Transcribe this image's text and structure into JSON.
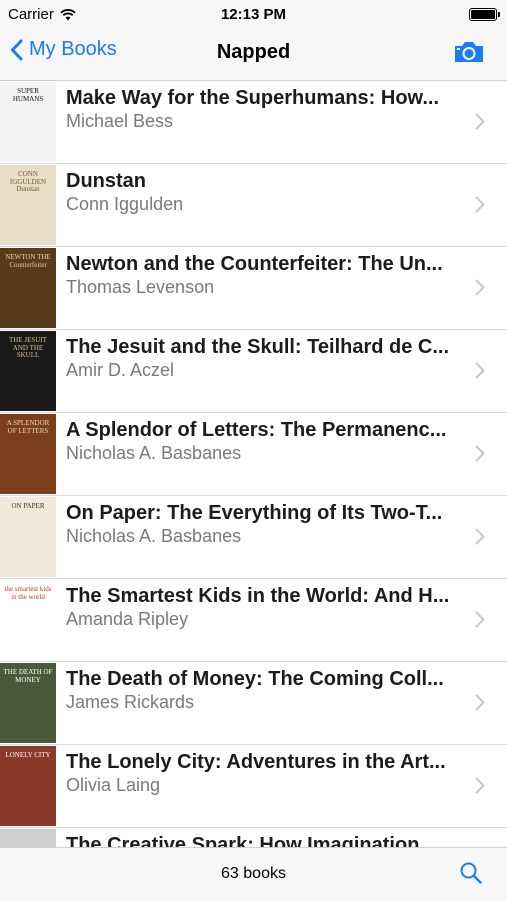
{
  "status": {
    "carrier": "Carrier",
    "time": "12:13 PM"
  },
  "nav": {
    "back_label": "My Books",
    "title": "Napped"
  },
  "books": [
    {
      "title": "Make Way for the Superhumans: How...",
      "author": "Michael Bess",
      "cover_text": "SUPER HUMANS",
      "cover_bg": "#f3f3f3",
      "cover_fg": "#111111"
    },
    {
      "title": "Dunstan",
      "author": "Conn Iggulden",
      "cover_text": "CONN IGGULDEN Dunstan",
      "cover_bg": "#e7dcc4",
      "cover_fg": "#7a5a2a"
    },
    {
      "title": "Newton and the Counterfeiter: The Un...",
      "author": "Thomas Levenson",
      "cover_text": "NEWTON THE Counterfeiter",
      "cover_bg": "#5a3a1d",
      "cover_fg": "#e8d3a0"
    },
    {
      "title": "The Jesuit and the Skull: Teilhard de C...",
      "author": "Amir D. Aczel",
      "cover_text": "THE JESUIT AND THE SKULL",
      "cover_bg": "#1a1a1a",
      "cover_fg": "#d8c08a"
    },
    {
      "title": "A Splendor of Letters: The Permanenc...",
      "author": "Nicholas A. Basbanes",
      "cover_text": "A SPLENDOR OF LETTERS",
      "cover_bg": "#7a3f1a",
      "cover_fg": "#f0dbb0"
    },
    {
      "title": "On Paper: The Everything of Its Two-T...",
      "author": "Nicholas A. Basbanes",
      "cover_text": "ON PAPER",
      "cover_bg": "#efe9dc",
      "cover_fg": "#333333"
    },
    {
      "title": "The Smartest Kids in the World: And H...",
      "author": "Amanda Ripley",
      "cover_text": "the smartest kids in the world",
      "cover_bg": "#ffffff",
      "cover_fg": "#c0392b"
    },
    {
      "title": "The Death of Money: The Coming Coll...",
      "author": "James Rickards",
      "cover_text": "THE DEATH OF MONEY",
      "cover_bg": "#4a5a38",
      "cover_fg": "#ffffff"
    },
    {
      "title": "The Lonely City: Adventures in the Art...",
      "author": "Olivia Laing",
      "cover_text": "LONELY CITY",
      "cover_bg": "#8a3a2a",
      "cover_fg": "#ffffff"
    },
    {
      "title": "The Creative Spark: How Imagination...",
      "author": "",
      "cover_text": "",
      "cover_bg": "#cfcfcf",
      "cover_fg": "#333333"
    }
  ],
  "footer": {
    "count_label": "63 books"
  },
  "colors": {
    "accent": "#1a7cf6"
  }
}
